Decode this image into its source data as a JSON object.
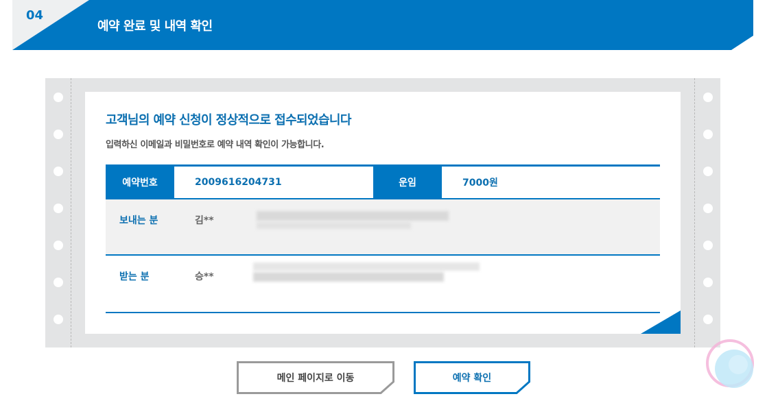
{
  "step": {
    "number": "04",
    "title": "예약 완료 및 내역 확인"
  },
  "message": {
    "title": "고객님의 예약 신청이 정상적으로 접수되었습니다",
    "subtitle": "입력하신 이메일과 비밀번호로 예약 내역 확인이 가능합니다."
  },
  "summary": {
    "reservation_label": "예약번호",
    "reservation_value": "2009616204731",
    "fare_label": "운임",
    "fare_value": "7000원"
  },
  "sender": {
    "label": "보내는 분",
    "name": "김**"
  },
  "receiver": {
    "label": "받는 분",
    "name": "승**"
  },
  "buttons": {
    "main_page": "메인 페이지로 이동",
    "confirm": "예약 확인"
  },
  "colors": {
    "brand_blue": "#0077c2",
    "text_blue": "#0b6fb0",
    "paper_gray": "#e3e4e5"
  }
}
